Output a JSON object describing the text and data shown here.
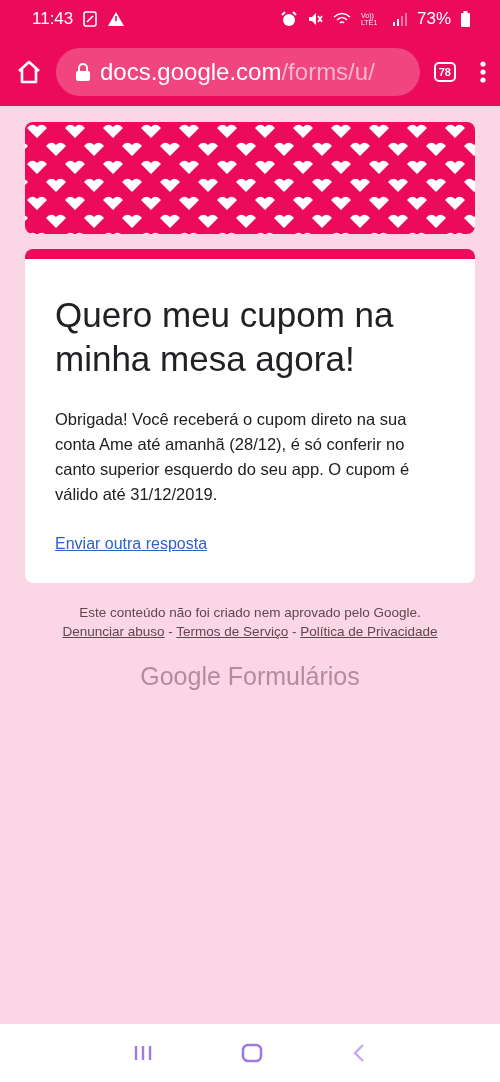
{
  "status_bar": {
    "time": "11:43",
    "network_label": "Vo)) LTE1",
    "battery": "73%"
  },
  "browser": {
    "domain": "docs.google.com",
    "path": "/forms/u/",
    "tab_count": "78"
  },
  "form": {
    "title": "Quero meu cupom na minha mesa agora!",
    "message": "Obrigada! Você receberá o cupom direto na sua conta Ame até amanhã (28/12), é só conferir no canto superior esquerdo do seu app. O cupom é válido até 31/12/2019.",
    "link": "Enviar outra resposta"
  },
  "footer": {
    "disclaimer": "Este conteúdo não foi criado nem aprovado pelo Google.",
    "links": [
      {
        "label": "Denunciar abuso",
        "separator": "-"
      },
      {
        "label": "Termos de Serviço",
        "separator": "-"
      },
      {
        "label": "Política de Privacidade"
      }
    ],
    "logo": {
      "brand": "Google",
      "product": "Formulários"
    }
  }
}
